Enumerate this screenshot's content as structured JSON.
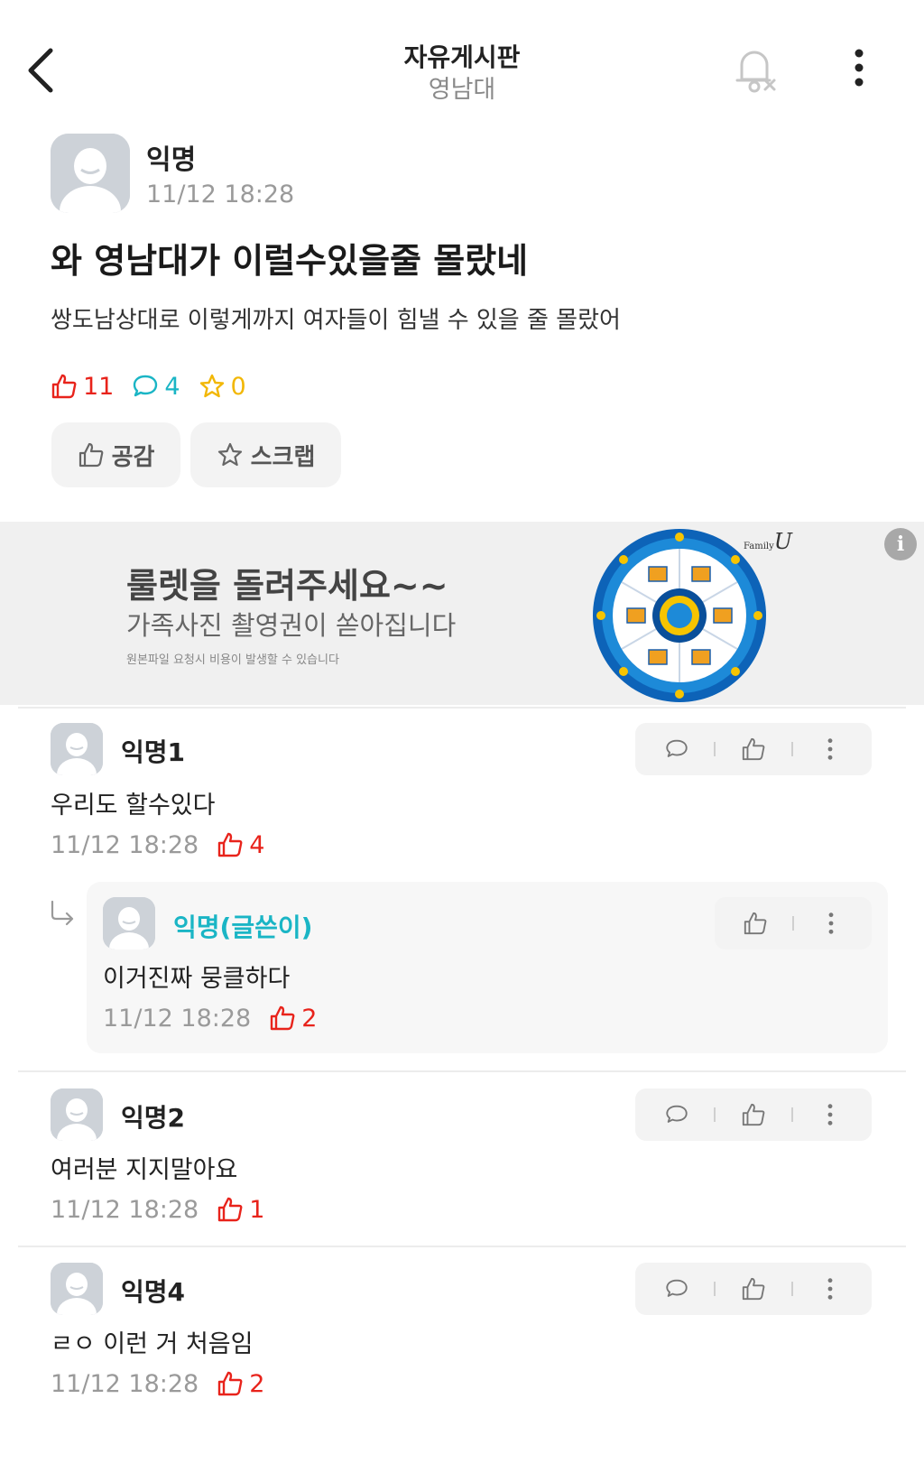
{
  "header": {
    "title": "자유게시판",
    "subtitle": "영남대"
  },
  "post": {
    "author": "익명",
    "time": "11/12 18:28",
    "title": "와 영남대가 이럴수있을줄 몰랐네",
    "body": "쌍도남상대로 이렇게까지 여자들이 힘낼 수 있을 줄 몰랐어",
    "likes": "11",
    "comments": "4",
    "scraps": "0",
    "like_button": "공감",
    "scrap_button": "스크랩"
  },
  "ad": {
    "headline": "룰렛을 돌려주세요~~",
    "subline": "가족사진 촬영권이 쏟아집니다",
    "fineprint": "원본파일 요청시 비용이 발생할 수 있습니다",
    "brand_small": "Family",
    "brand_big": "U",
    "info_icon": "i"
  },
  "comments": [
    {
      "author": "익명1",
      "text": "우리도 할수있다",
      "time": "11/12 18:28",
      "likes": "4",
      "is_op": false
    },
    {
      "author": "익명(글쓴이)",
      "text": "이거진짜 뭉클하다",
      "time": "11/12 18:28",
      "likes": "2",
      "is_op": true,
      "is_reply": true
    },
    {
      "author": "익명2",
      "text": "여러분 지지말아요",
      "time": "11/12 18:28",
      "likes": "1",
      "is_op": false
    },
    {
      "author": "익명4",
      "text": "ㄹㅇ 이런 거 처음임",
      "time": "11/12 18:28",
      "likes": "2",
      "is_op": false
    }
  ],
  "colors": {
    "like_red": "#e8231b",
    "comment_teal": "#1ab5c5",
    "scrap_gold": "#f2b705"
  },
  "icons": [
    "back-arrow-icon",
    "bell-off-icon",
    "more-vertical-icon",
    "thumbs-up-icon",
    "speech-bubble-icon",
    "star-icon",
    "reply-arrow-icon",
    "info-icon"
  ]
}
